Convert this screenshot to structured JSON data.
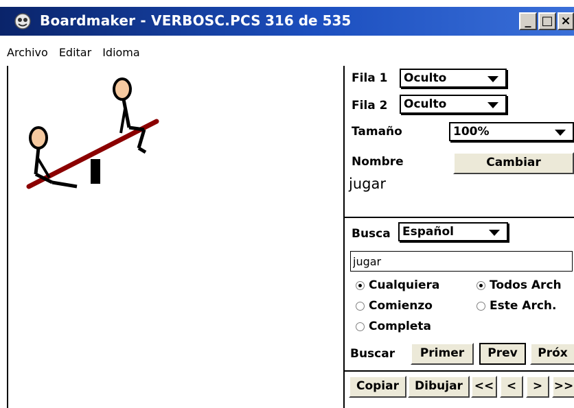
{
  "window": {
    "title": "Boardmaker - VERBOSC.PCS",
    "count": "316 de 535",
    "buttons": {
      "minimize": "_",
      "maximize": "□",
      "close": "×"
    }
  },
  "menu": [
    "Archivo",
    "Editar",
    "Idioma"
  ],
  "panel": {
    "fila1": {
      "label": "Fila 1",
      "value": "Oculto"
    },
    "fila2": {
      "label": "Fila 2",
      "value": "Oculto"
    },
    "tamano": {
      "label": "Tamaño",
      "value": "100%"
    },
    "nombre": {
      "label": "Nombre",
      "button": "Cambiar",
      "value": "jugar"
    },
    "busca": {
      "label": "Busca",
      "value": "Español"
    },
    "search_text": "jugar",
    "radios": {
      "cualquiera": {
        "label": "Cualquiera",
        "checked": true
      },
      "comienzo": {
        "label": "Comienzo",
        "checked": false
      },
      "completa": {
        "label": "Completa",
        "checked": false
      },
      "todos": {
        "label": "Todos Arch",
        "checked": true
      },
      "este": {
        "label": "Este Arch.",
        "checked": false
      }
    },
    "buscar": {
      "label": "Buscar",
      "primer": "Primer",
      "prev": "Prev",
      "prox": "Próx"
    },
    "bottom": {
      "copiar": "Copiar",
      "dibujar": "Dibujar",
      "first": "<<",
      "prev": "<",
      "next": ">",
      "last": ">>"
    }
  },
  "colors": {
    "titlebar": "#0a246a",
    "seesaw": "#8b0000",
    "skin": "#f5c9a0"
  }
}
